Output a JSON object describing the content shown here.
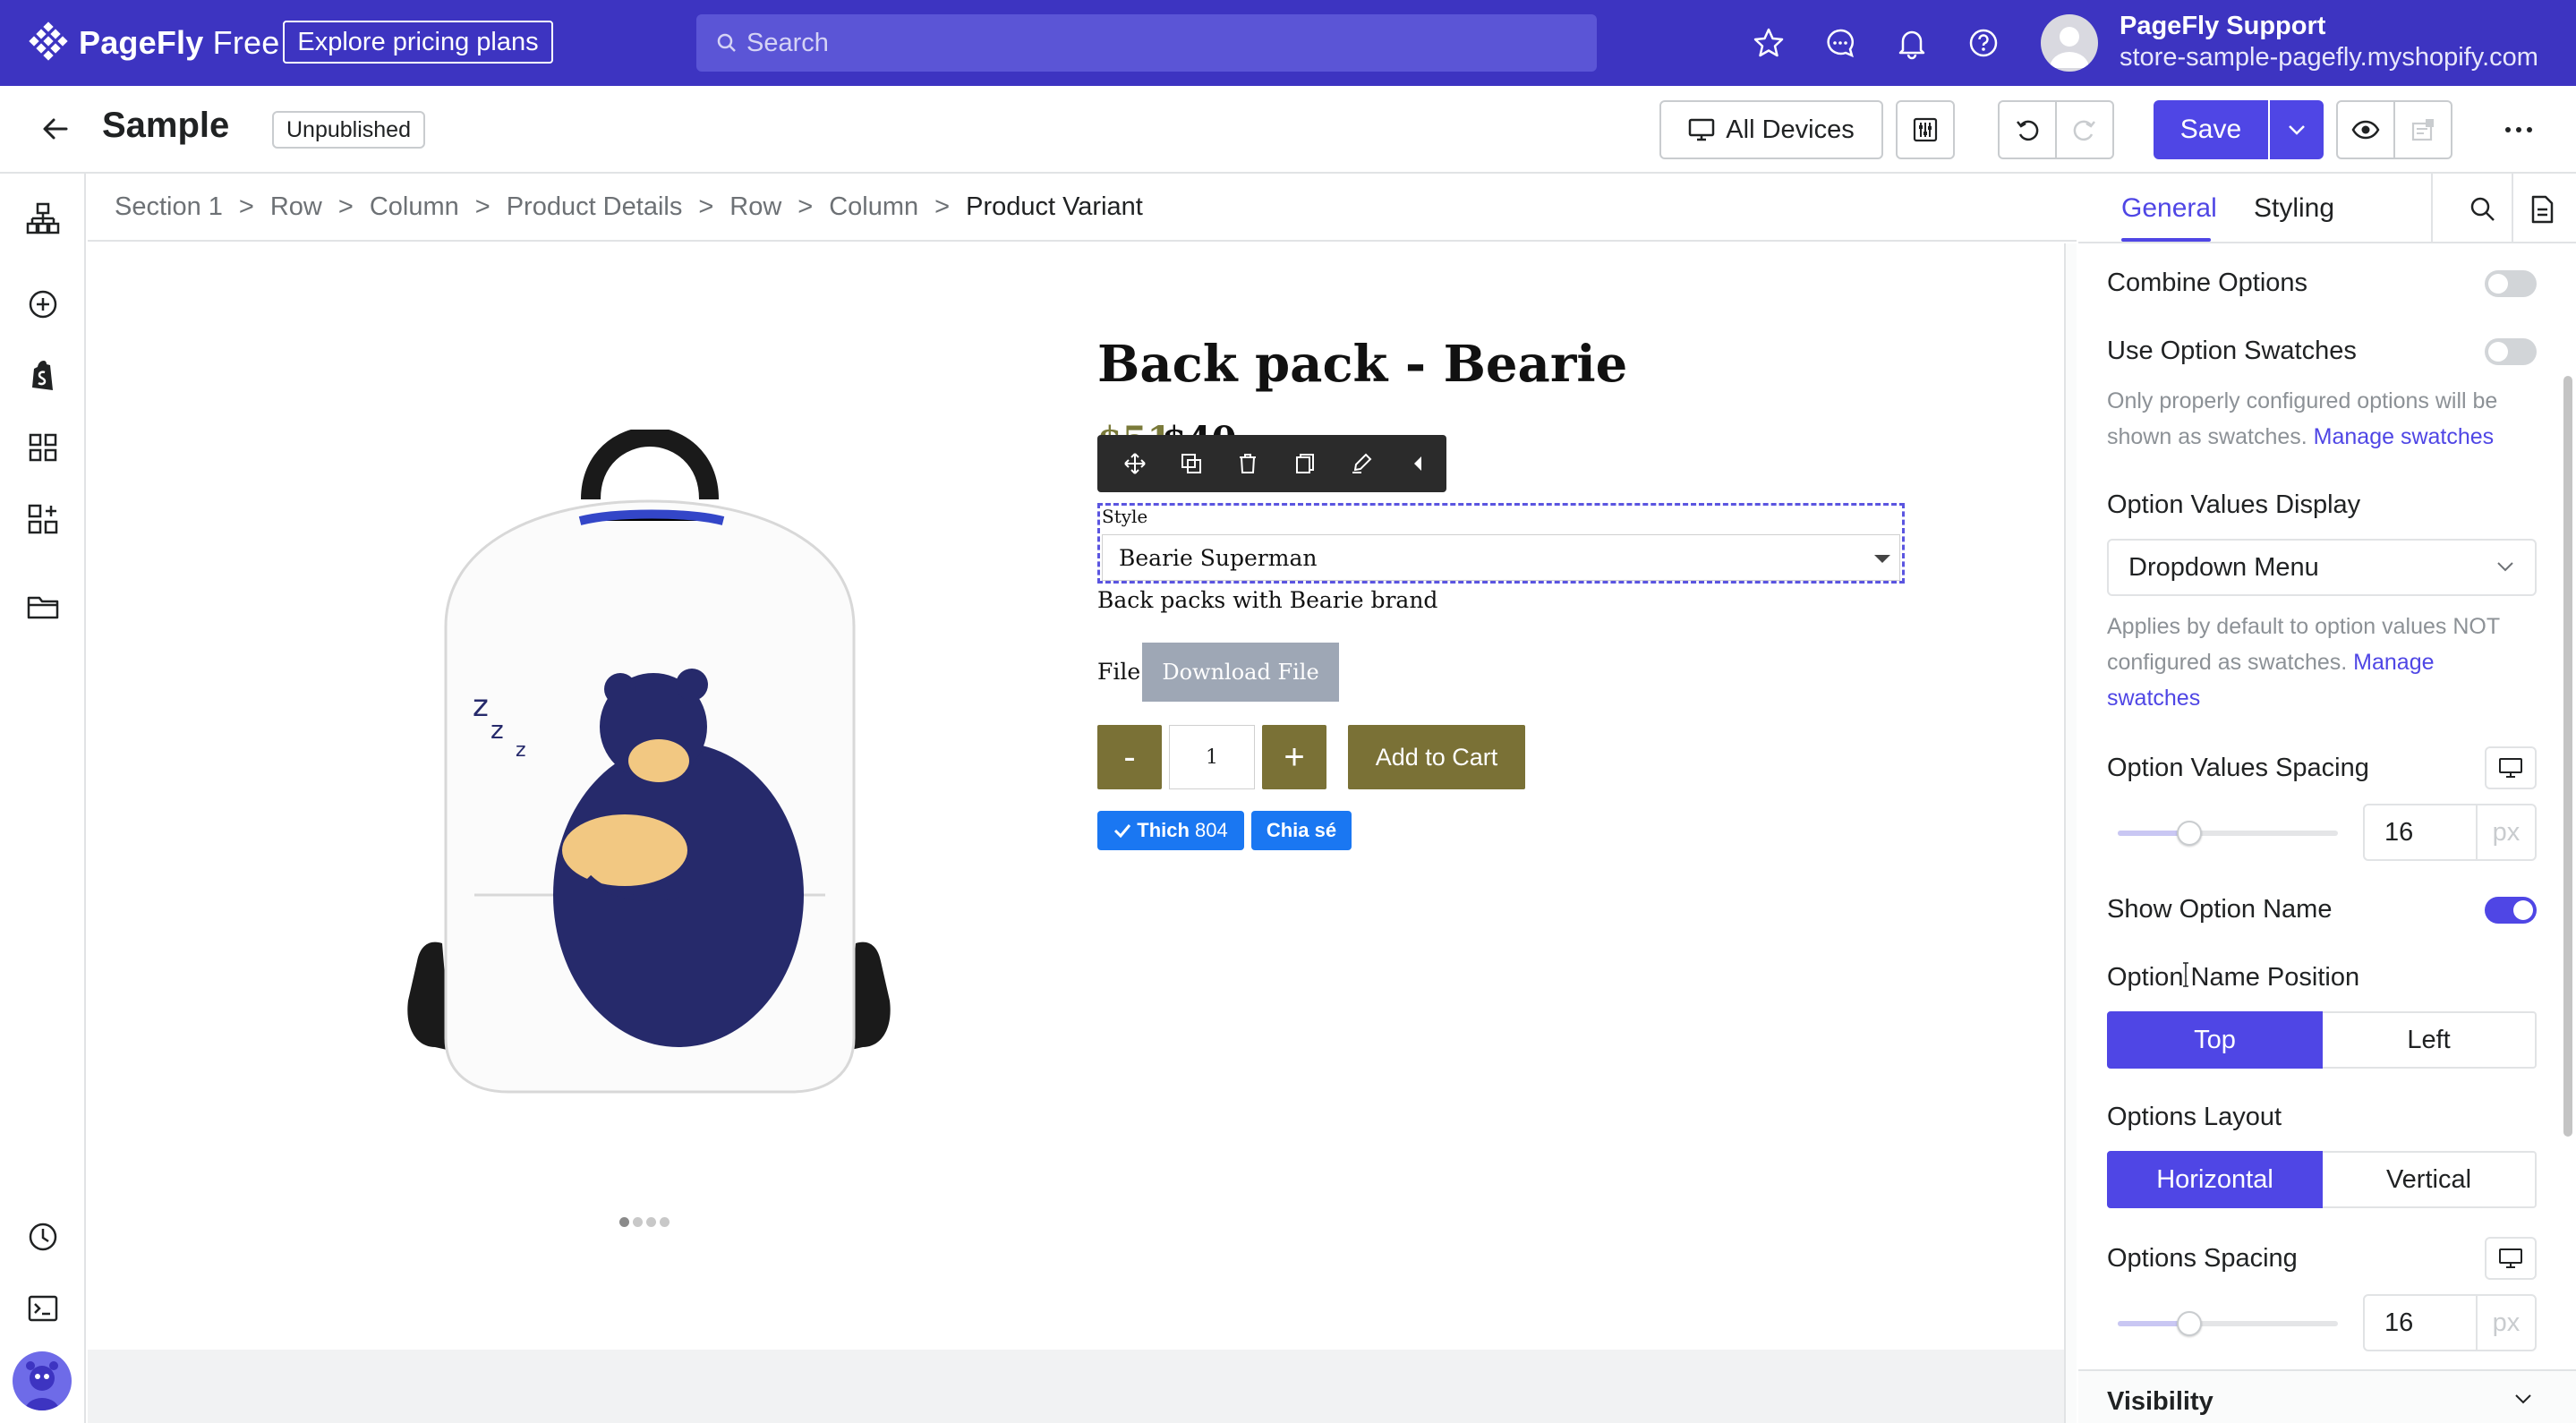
{
  "topbar": {
    "brand_name": "PageFly",
    "brand_plan": "Free",
    "explore_label": "Explore pricing plans",
    "search_placeholder": "Search",
    "icons": [
      "star-icon",
      "chat-icon",
      "bell-icon",
      "help-icon"
    ],
    "store_name": "PageFly Support",
    "store_domain": "store-sample-pagefly.myshopify.com",
    "bg_color": "#3d34c1"
  },
  "pagebar": {
    "title": "Sample",
    "status": "Unpublished",
    "devices_label": "All Devices",
    "save_label": "Save",
    "accent_color": "#4f46e5"
  },
  "leftrail": {
    "icons": [
      "page-outline-icon",
      "add-element-icon",
      "shopify-icon",
      "page-templates-icon",
      "integrations-icon",
      "folder-icon",
      "history-icon",
      "code-icon"
    ]
  },
  "breadcrumb": [
    "Section 1",
    "Row",
    "Column",
    "Product Details",
    "Row",
    "Column",
    "Product Variant"
  ],
  "product": {
    "title": "Back pack - Bearie",
    "price_old": "$51",
    "price_new": "$40",
    "variant_label": "Style",
    "variant_value": "Bearie Superman",
    "description": "Back packs with Bearie brand",
    "file_label": "File",
    "download_label": "Download File",
    "qty_minus": "-",
    "qty_value": "1",
    "qty_plus": "+",
    "add_to_cart": "Add to Cart",
    "like_label": "Thich",
    "like_count": "804",
    "share_label": "Chia sé",
    "gallery_dots": 4,
    "gallery_active": 1,
    "button_color": "#7a7136",
    "social_color": "#1a77f2"
  },
  "panel": {
    "tabs": [
      "General",
      "Styling"
    ],
    "active_tab": "General",
    "combine_options": {
      "label": "Combine Options",
      "on": false
    },
    "use_swatches": {
      "label": "Use Option Swatches",
      "on": false
    },
    "swatches_help": "Only properly configured options will be shown as swatches.",
    "manage_swatches_link": "Manage swatches",
    "values_display": {
      "label": "Option Values Display",
      "value": "Dropdown Menu"
    },
    "values_display_help": "Applies by default to option values NOT configured as swatches.",
    "manage_link_1": "Manage",
    "manage_link_2": "swatches",
    "values_spacing": {
      "label": "Option Values Spacing",
      "value": "16",
      "unit": "px"
    },
    "show_option_name": {
      "label": "Show Option Name",
      "on": true
    },
    "name_position": {
      "label": "Option Name Position",
      "options": [
        "Top",
        "Left"
      ],
      "selected": "Top"
    },
    "options_layout": {
      "label": "Options Layout",
      "options": [
        "Horizontal",
        "Vertical"
      ],
      "selected": "Horizontal"
    },
    "options_spacing": {
      "label": "Options Spacing",
      "value": "16",
      "unit": "px"
    },
    "visibility_label": "Visibility"
  }
}
